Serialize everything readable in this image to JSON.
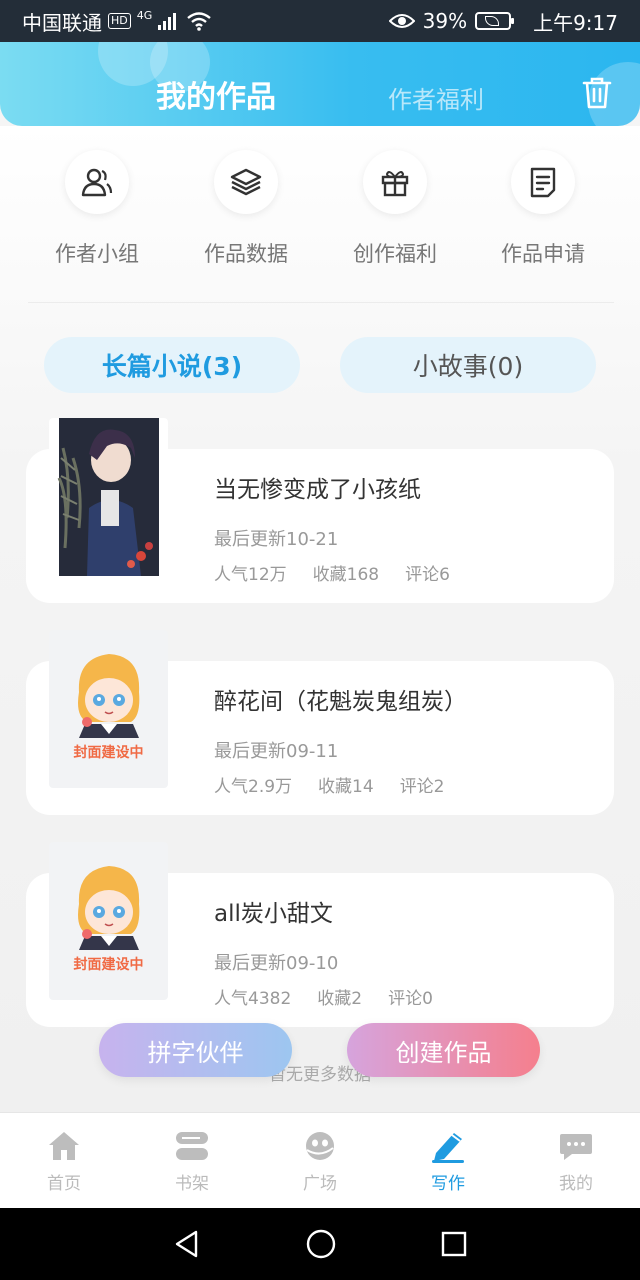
{
  "status_bar": {
    "carrier": "中国联通",
    "hd": "HD",
    "network": "4G",
    "battery": "39%",
    "time": "上午9:17"
  },
  "header": {
    "tab_active": "我的作品",
    "tab_inactive": "作者福利",
    "trash_icon": "trash-icon"
  },
  "quick_actions": [
    {
      "label": "作者小组",
      "icon": "users-icon"
    },
    {
      "label": "作品数据",
      "icon": "layers-icon"
    },
    {
      "label": "创作福利",
      "icon": "gift-icon"
    },
    {
      "label": "作品申请",
      "icon": "document-icon"
    }
  ],
  "segments": {
    "novel": "长篇小说(3)",
    "story": "小故事(0)"
  },
  "works": [
    {
      "title": "当无惨变成了小孩纸",
      "updated": "最后更新10-21",
      "popularity": "人气12万",
      "favorites": "收藏168",
      "comments": "评论6",
      "cover": "illustrated-cover"
    },
    {
      "title": "醉花间（花魁炭鬼组炭）",
      "updated": "最后更新09-11",
      "popularity": "人气2.9万",
      "favorites": "收藏14",
      "comments": "评论2",
      "cover_caption": "封面建设中"
    },
    {
      "title": "all炭小甜文",
      "updated": "最后更新09-10",
      "popularity": "人气4382",
      "favorites": "收藏2",
      "comments": "评论0",
      "cover_caption": "封面建设中"
    }
  ],
  "no_more": "暂无更多数据",
  "buttons": {
    "partner": "拼字伙伴",
    "create": "创建作品"
  },
  "tabbar": [
    {
      "label": "首页",
      "icon": "home-icon"
    },
    {
      "label": "书架",
      "icon": "bookshelf-icon"
    },
    {
      "label": "广场",
      "icon": "plaza-icon"
    },
    {
      "label": "写作",
      "icon": "pen-icon",
      "active": true
    },
    {
      "label": "我的",
      "icon": "chat-icon"
    }
  ],
  "colors": {
    "accent": "#1f9be0",
    "header_gradient_start": "#7bdcf2",
    "header_gradient_end": "#2bb6ef",
    "create_button": "#f57f8d"
  }
}
